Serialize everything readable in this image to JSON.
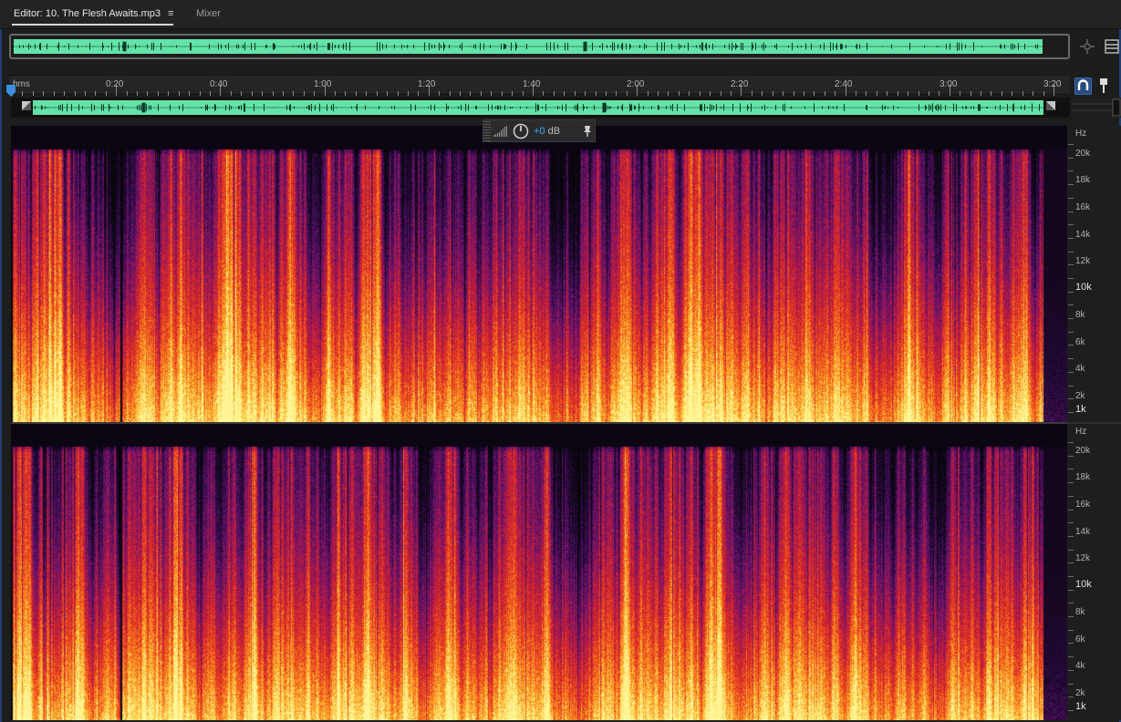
{
  "tabs": {
    "editor_label": "Editor: 10. The Flesh Awaits.mp3",
    "menu_glyph": "≡",
    "mixer_label": "Mixer"
  },
  "ruler": {
    "unit_label": "hms",
    "ticks": [
      "0:20",
      "0:40",
      "1:00",
      "1:20",
      "1:40",
      "2:00",
      "2:20",
      "2:40",
      "3:00",
      "3:20"
    ]
  },
  "hud": {
    "gain_value": "+0",
    "gain_unit": "dB"
  },
  "hz_scale": {
    "unit": "Hz",
    "labels": [
      "20k",
      "18k",
      "16k",
      "14k",
      "12k",
      "10k",
      "8k",
      "6k",
      "4k",
      "2k",
      "1k"
    ],
    "major": [
      "10k",
      "1k"
    ]
  },
  "icons": {
    "zoom_overview": "zoom-navigator-icon",
    "panel_menu": "panel-menu-icon",
    "snap": "snap-magnet-icon",
    "marker": "marker-pin-icon",
    "meter": "level-meter-icon",
    "knob": "gain-knob-icon",
    "pin": "pin-icon"
  },
  "colors": {
    "waveform_green": "#63e3a8",
    "accent_blue": "#3ea6ff",
    "frame_blue": "#1f3e6e"
  }
}
